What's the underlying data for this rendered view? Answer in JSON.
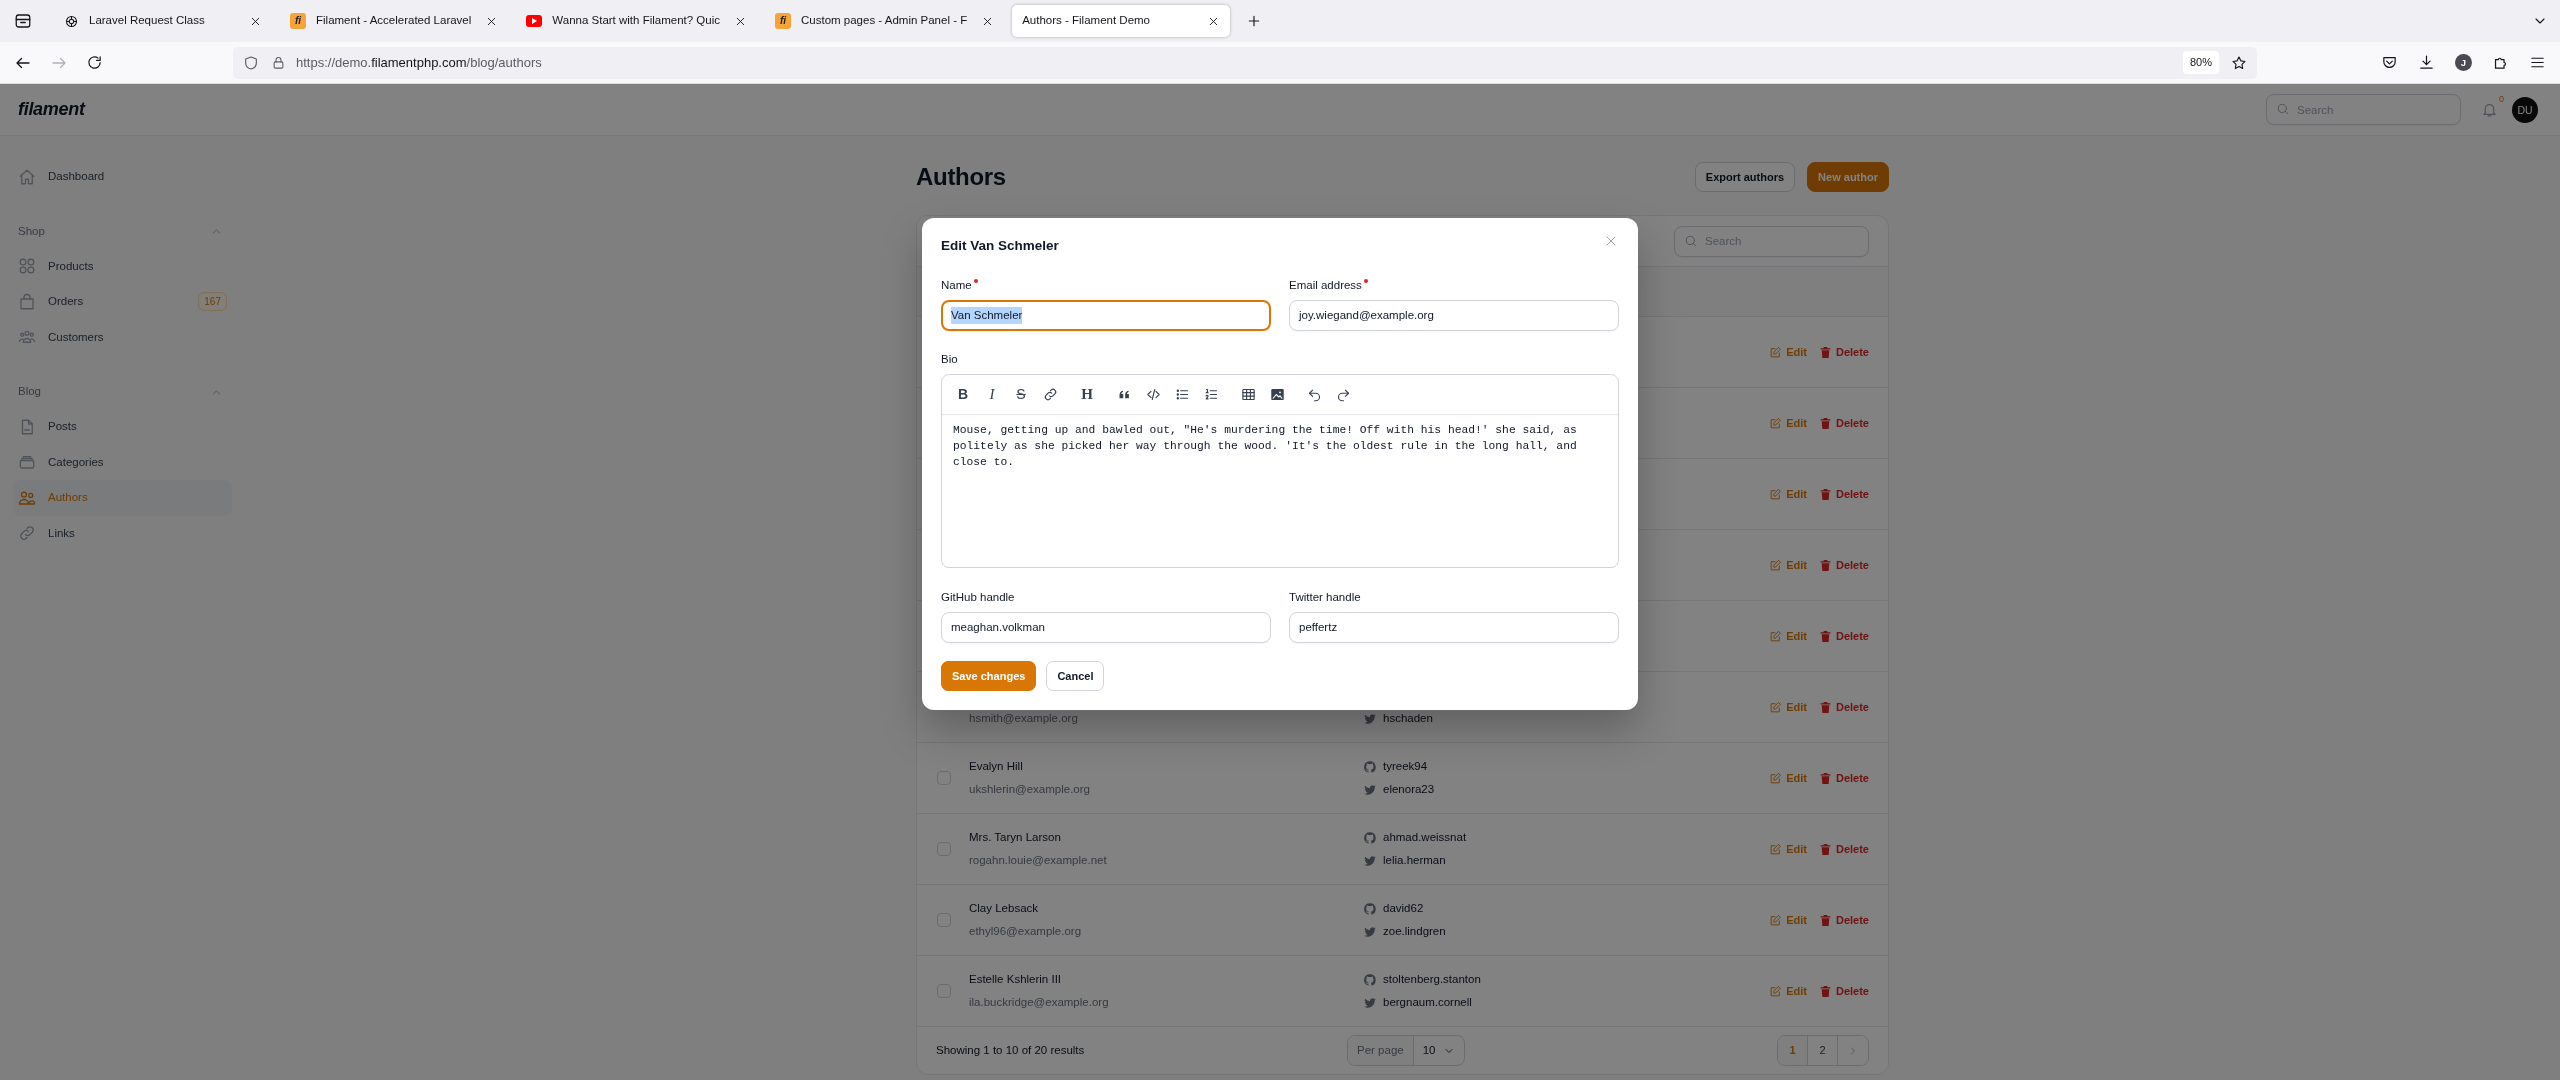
{
  "browser": {
    "tabs": [
      {
        "title": "Laravel Request Class",
        "kind": "swirl",
        "selected": false
      },
      {
        "title": "Filament - Accelerated Laravel",
        "kind": "letters",
        "favicon_text": "fi",
        "selected": false
      },
      {
        "title": "Wanna Start with Filament? Quic",
        "kind": "play",
        "selected": false
      },
      {
        "title": "Custom pages - Admin Panel - F",
        "kind": "letters",
        "favicon_text": "fi",
        "selected": false
      },
      {
        "title": "Authors - Filament Demo",
        "kind": "plain",
        "selected": true
      }
    ],
    "url": {
      "prefix": "https://demo.",
      "domain": "filamentphp.com",
      "path": "/blog/authors"
    },
    "zoom": "80%",
    "profile_initial": "J"
  },
  "topbar": {
    "logo": "filament",
    "search": {
      "placeholder": "Search"
    },
    "notifications": "0",
    "avatar": "DU"
  },
  "sidebar": {
    "items": [
      {
        "label": "Dashboard",
        "kind": "home",
        "selected": false
      }
    ],
    "groups": [
      {
        "label": "Shop",
        "expanded": true,
        "items": [
          {
            "label": "Products",
            "kind": "squares",
            "selected": false
          },
          {
            "label": "Orders",
            "kind": "bag",
            "badge": "167",
            "selected": false
          },
          {
            "label": "Customers",
            "kind": "group",
            "selected": false
          }
        ]
      },
      {
        "label": "Blog",
        "expanded": true,
        "items": [
          {
            "label": "Posts",
            "kind": "doc",
            "selected": false
          },
          {
            "label": "Categories",
            "kind": "stack",
            "selected": false
          },
          {
            "label": "Authors",
            "kind": "users",
            "selected": true
          },
          {
            "label": "Links",
            "kind": "link",
            "selected": false
          }
        ]
      }
    ]
  },
  "page": {
    "title": "Authors",
    "actions": [
      {
        "label": "Export authors",
        "kind": "secondary"
      },
      {
        "label": "New author",
        "kind": "primary"
      }
    ]
  },
  "table": {
    "search": {
      "placeholder": "Search"
    },
    "rows": [
      {
        "actions": [
          {
            "label": "Edit",
            "kind": "edit"
          },
          {
            "label": "Delete",
            "kind": "delete"
          }
        ]
      },
      {
        "actions": [
          {
            "label": "Edit",
            "kind": "edit"
          },
          {
            "label": "Delete",
            "kind": "delete"
          }
        ]
      },
      {
        "actions": [
          {
            "label": "Edit",
            "kind": "edit"
          },
          {
            "label": "Delete",
            "kind": "delete"
          }
        ]
      },
      {
        "actions": [
          {
            "label": "Edit",
            "kind": "edit"
          },
          {
            "label": "Delete",
            "kind": "delete"
          }
        ]
      },
      {
        "actions": [
          {
            "label": "Edit",
            "kind": "edit"
          },
          {
            "label": "Delete",
            "kind": "delete"
          }
        ]
      },
      {
        "email": "hsmith@example.org",
        "twitter": "hschaden",
        "actions": [
          {
            "label": "Edit",
            "kind": "edit"
          },
          {
            "label": "Delete",
            "kind": "delete"
          }
        ]
      },
      {
        "checked": false,
        "name": "Evalyn Hill",
        "email": "ukshlerin@example.org",
        "github": "tyreek94",
        "twitter": "elenora23",
        "actions": [
          {
            "label": "Edit",
            "kind": "edit"
          },
          {
            "label": "Delete",
            "kind": "delete"
          }
        ]
      },
      {
        "checked": false,
        "name": "Mrs. Taryn Larson",
        "email": "rogahn.louie@example.net",
        "github": "ahmad.weissnat",
        "twitter": "lelia.herman",
        "actions": [
          {
            "label": "Edit",
            "kind": "edit"
          },
          {
            "label": "Delete",
            "kind": "delete"
          }
        ]
      },
      {
        "checked": false,
        "name": "Clay Lebsack",
        "email": "ethyl96@example.org",
        "github": "david62",
        "twitter": "zoe.lindgren",
        "actions": [
          {
            "label": "Edit",
            "kind": "edit"
          },
          {
            "label": "Delete",
            "kind": "delete"
          }
        ]
      },
      {
        "checked": false,
        "name": "Estelle Kshlerin III",
        "email": "ila.buckridge@example.org",
        "github": "stoltenberg.stanton",
        "twitter": "bergnaum.cornell",
        "actions": [
          {
            "label": "Edit",
            "kind": "edit"
          },
          {
            "label": "Delete",
            "kind": "delete"
          }
        ]
      }
    ],
    "footer": {
      "summary": "Showing 1 to 10 of 20 results",
      "per_page_label": "Per page",
      "per_page_value": "10",
      "pages": [
        {
          "label": "1",
          "selected": true
        },
        {
          "label": "2",
          "selected": false
        }
      ]
    }
  },
  "modal": {
    "title": "Edit Van Schmeler",
    "fields": [
      {
        "label": "Name",
        "required": true,
        "value": "Van Schmeler",
        "focused": true,
        "text_selected": true
      },
      {
        "label": "Email address",
        "required": true,
        "value": "joy.wiegand@example.org",
        "focused": false,
        "text_selected": false
      }
    ],
    "bio": {
      "label": "Bio",
      "toolbar": [
        [
          {
            "kind": "bold",
            "glyph": "B"
          },
          {
            "kind": "italic",
            "glyph": "I"
          },
          {
            "kind": "strike",
            "glyph": "S"
          },
          {
            "kind": "link"
          }
        ],
        [
          {
            "kind": "heading",
            "glyph": "H"
          }
        ],
        [
          {
            "kind": "quote"
          },
          {
            "kind": "code"
          },
          {
            "kind": "bullets"
          },
          {
            "kind": "numbers"
          }
        ],
        [
          {
            "kind": "table"
          },
          {
            "kind": "image"
          }
        ],
        [
          {
            "kind": "undo"
          },
          {
            "kind": "redo"
          }
        ]
      ],
      "text": "Mouse, getting up and bawled out, \"He's murdering the time! Off with his head!' she said, as politely as she picked her way through the wood. 'It's the oldest rule in the long hall, and close to."
    },
    "handles": [
      {
        "label": "GitHub handle",
        "value": "meaghan.volkman",
        "focused": false,
        "text_selected": false
      },
      {
        "label": "Twitter handle",
        "value": "peffertz",
        "focused": false,
        "text_selected": false
      }
    ],
    "buttons": [
      {
        "label": "Save changes",
        "kind": "primary"
      },
      {
        "label": "Cancel",
        "kind": "secondary"
      }
    ]
  }
}
